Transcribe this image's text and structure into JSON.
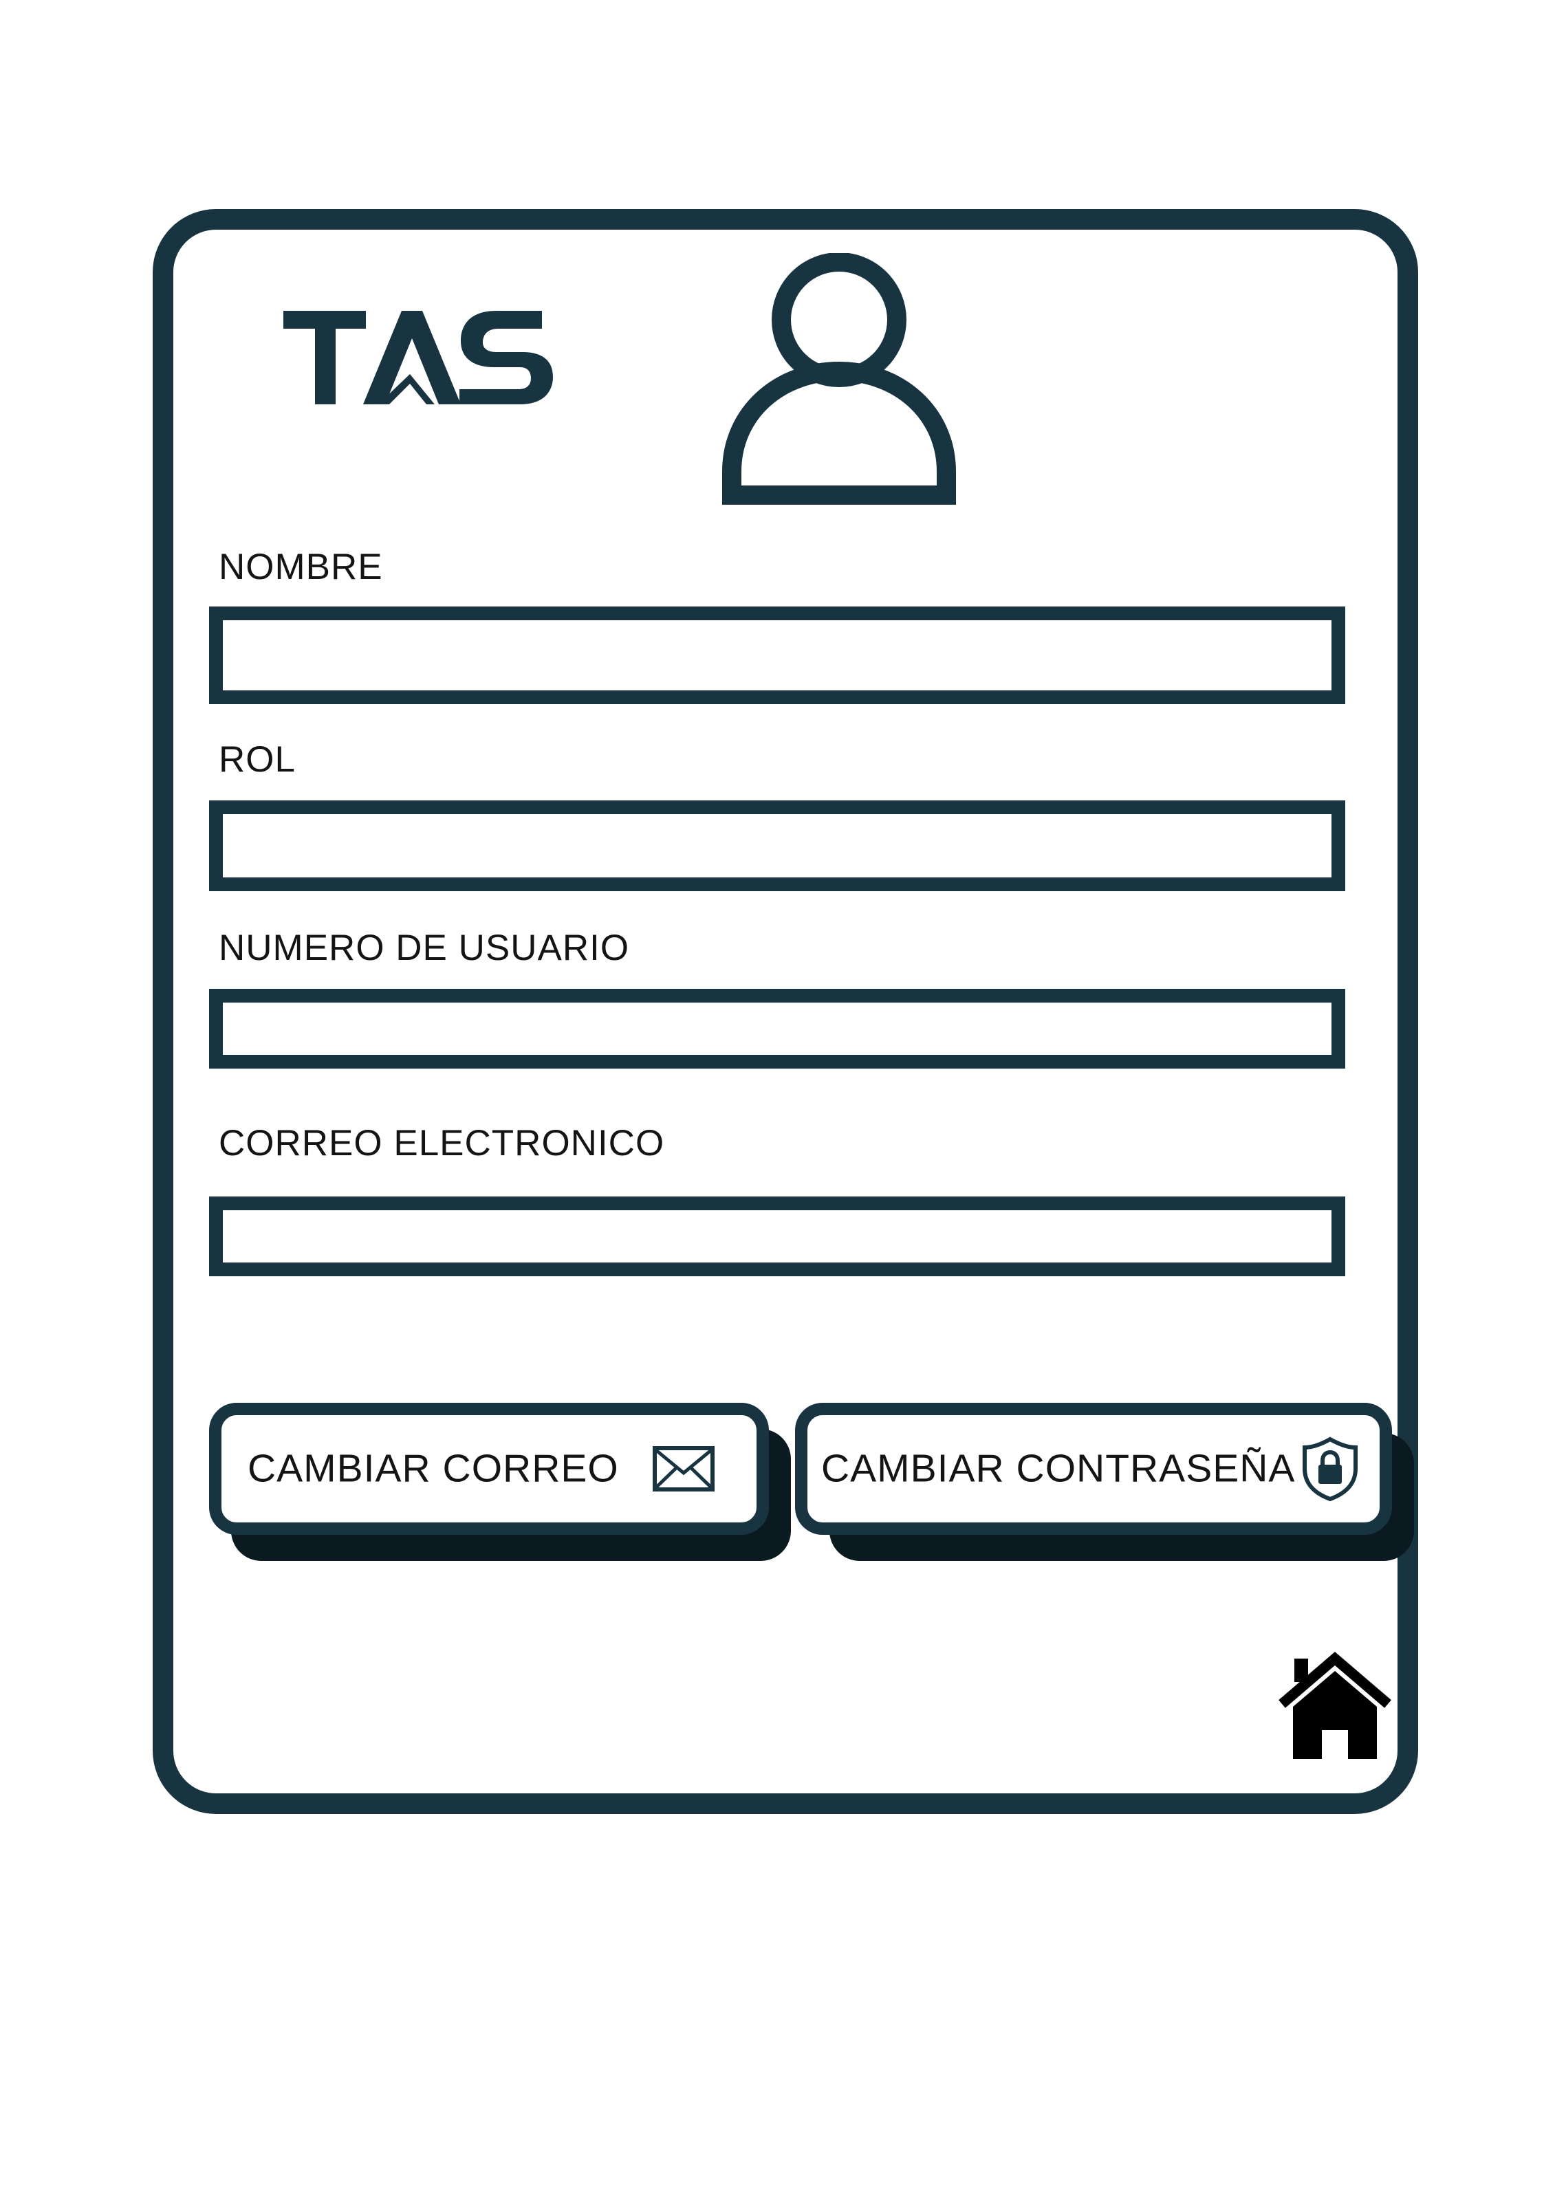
{
  "app": {
    "logo_text": "TAS"
  },
  "form": {
    "fields": [
      {
        "label": "NOMBRE",
        "value": ""
      },
      {
        "label": "ROL",
        "value": ""
      },
      {
        "label": "NUMERO DE USUARIO",
        "value": ""
      },
      {
        "label": "CORREO ELECTRONICO",
        "value": ""
      }
    ]
  },
  "actions": {
    "change_email": {
      "label": "CAMBIAR CORREO",
      "icon": "envelope-icon"
    },
    "change_password": {
      "label": "CAMBIAR CONTRASEÑA",
      "icon": "shield-lock-icon"
    }
  },
  "nav": {
    "home_icon": "home-icon"
  },
  "colors": {
    "primary": "#183440",
    "shadow": "#0a1a20",
    "text": "#141414",
    "background": "#ffffff"
  }
}
